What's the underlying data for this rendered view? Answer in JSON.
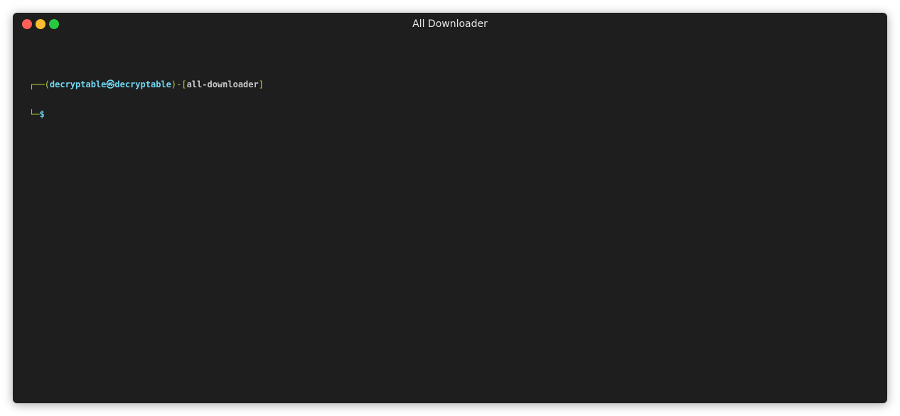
{
  "window": {
    "title": "All Downloader"
  },
  "prompt": {
    "top_corner": "┌──(",
    "user": "decryptable",
    "separator": "㉿",
    "host": "decryptable",
    "mid": ")-[",
    "cwd": "all-downloader",
    "close_bracket": "]",
    "bottom_corner": "└─",
    "symbol": "$"
  },
  "colors": {
    "prompt_frame": "#b5d23b",
    "prompt_user_host": "#6fd7f0",
    "cwd": "#c8c8c8",
    "background": "#1e1e1e"
  }
}
